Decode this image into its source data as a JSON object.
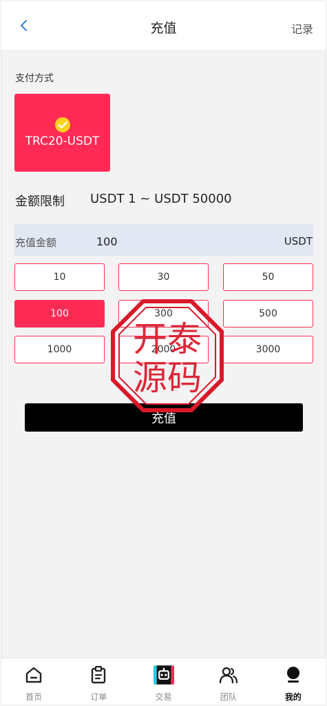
{
  "header": {
    "title": "充值",
    "record_label": "记录",
    "back_icon": "chevron-left-icon"
  },
  "payment": {
    "section_label": "支付方式",
    "method_label": "TRC20-USDT",
    "selected": true,
    "accent_color": "#ff2b55"
  },
  "limit": {
    "label": "金额限制",
    "value": "USDT 1 ~ USDT 50000"
  },
  "amount": {
    "label": "充值金额",
    "value": "100",
    "unit": "USDT"
  },
  "presets": [
    {
      "label": "10"
    },
    {
      "label": "30"
    },
    {
      "label": "50"
    },
    {
      "label": "100",
      "selected": true
    },
    {
      "label": "300"
    },
    {
      "label": "500"
    },
    {
      "label": "1000"
    },
    {
      "label": "2000"
    },
    {
      "label": "3000"
    }
  ],
  "submit_label": "充值",
  "watermark": {
    "line1": "开泰",
    "line2": "源码"
  },
  "tabbar": {
    "items": [
      {
        "label": "首页",
        "icon": "home-icon"
      },
      {
        "label": "订单",
        "icon": "clipboard-icon"
      },
      {
        "label": "交易",
        "icon": "robot-icon"
      },
      {
        "label": "团队",
        "icon": "team-icon"
      },
      {
        "label": "我的",
        "icon": "user-icon",
        "active": true
      }
    ]
  }
}
